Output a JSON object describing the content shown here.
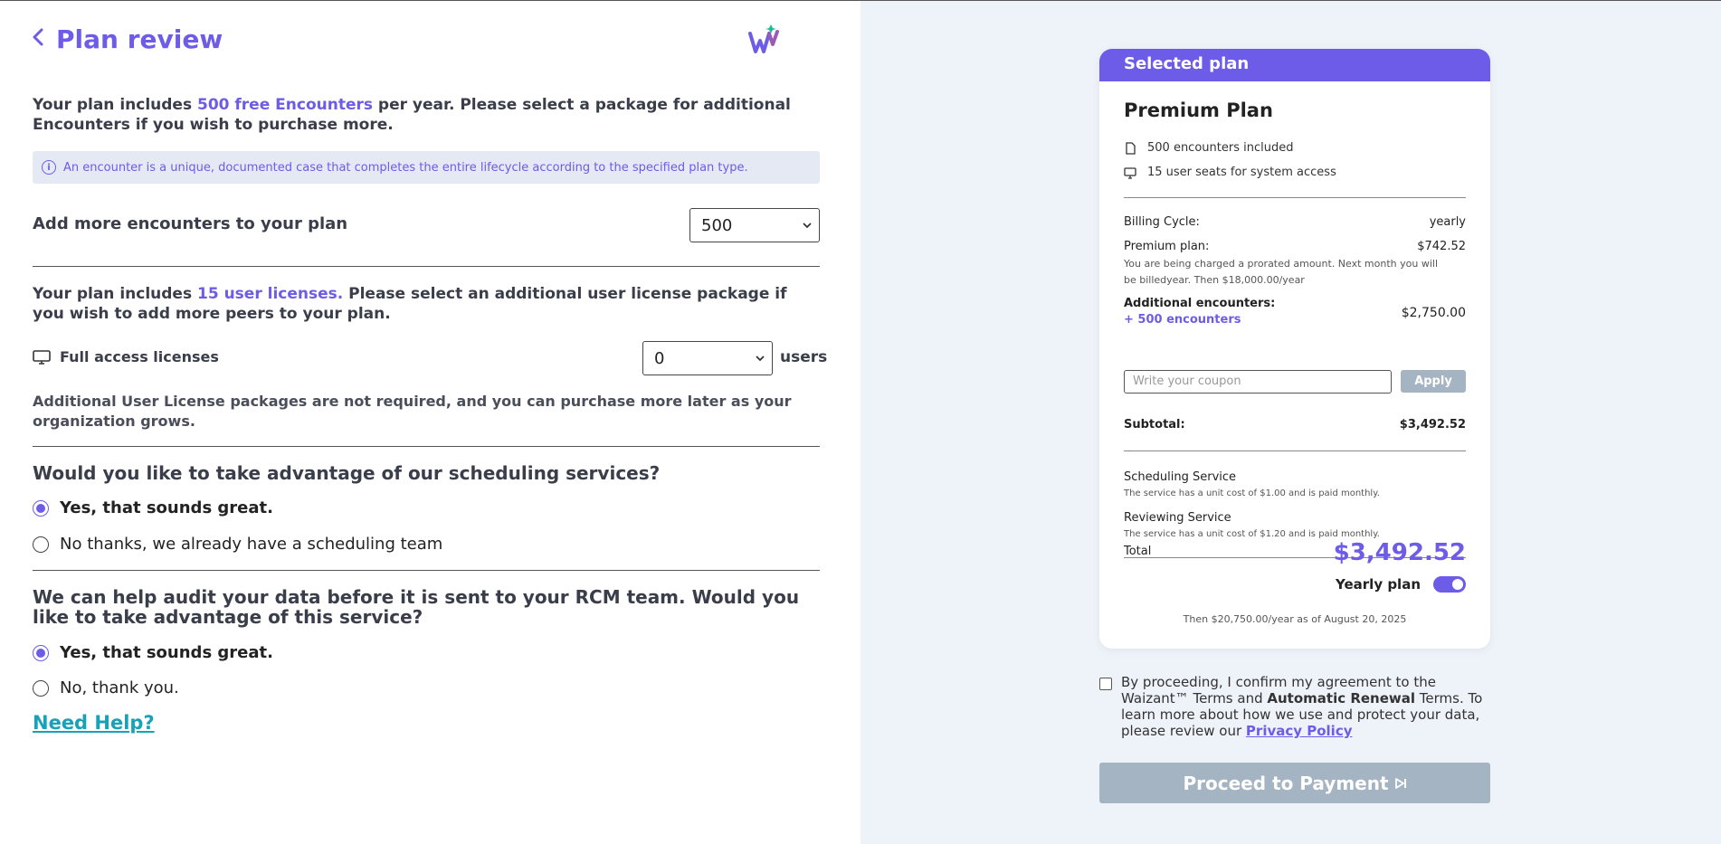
{
  "header": {
    "back_icon": "chevron-left-icon",
    "title": "Plan review",
    "logo": "waizant-logo"
  },
  "encounters": {
    "intro_pre": "Your plan includes ",
    "intro_accent": "500 free Encounters",
    "intro_post": " per year. Please select a package for additional Encounters if you wish to purchase more.",
    "info_text": "An encounter is a unique, documented case that completes the entire lifecycle according to the specified plan type.",
    "add_label": "Add more encounters to your plan",
    "selected": "500"
  },
  "licenses": {
    "intro_pre": "Your plan includes ",
    "intro_accent": "15 user licenses.",
    "intro_post": " Please select an additional user license package if you wish to add more peers to your plan.",
    "row_label": "Full access licenses",
    "selected": "0",
    "unit": "users",
    "note": "Additional User License packages are not required, and you can purchase more later as your organization grows."
  },
  "scheduling": {
    "question": "Would you like to take advantage of our scheduling services?",
    "options": [
      "Yes, that sounds great.",
      "No thanks, we already have a scheduling team"
    ],
    "selected_index": 0
  },
  "audit": {
    "question": "We can help audit your data before it is sent to your RCM team. Would you like to take advantage of this service?",
    "options": [
      "Yes, that sounds great.",
      "No, thank you."
    ],
    "selected_index": 0
  },
  "help_link": "Need Help?",
  "summary": {
    "header": "Selected plan",
    "plan_name": "Premium Plan",
    "features": [
      "500 encounters included",
      "15 user seats for system access"
    ],
    "billing_cycle_label": "Billing Cycle:",
    "billing_cycle_value": "yearly",
    "premium_label": "Premium plan:",
    "premium_value": "$742.52",
    "prorated_note": "You are being charged a prorated amount. Next month you will be billedyear. Then $18,000.00/year",
    "additional_label": "Additional encounters:",
    "additional_detail": "+ 500 encounters",
    "additional_value": "$2,750.00",
    "coupon_placeholder": "Write your coupon",
    "apply_label": "Apply",
    "subtotal_label": "Subtotal:",
    "subtotal_value": "$3,492.52",
    "services": [
      {
        "title": "Scheduling Service",
        "desc": "The service has a unit cost of $1.00 and is paid monthly."
      },
      {
        "title": "Reviewing Service",
        "desc": "The service has a unit cost of $1.20 and is paid monthly."
      }
    ],
    "total_label": "Total",
    "total_value": "$3,492.52",
    "yearly_label": "Yearly plan",
    "yearly_on": true,
    "then_note": "Then $20,750.00/year as of August 20, 2025"
  },
  "agreement": {
    "text_1": "By proceeding, I confirm my agreement to the Waizant™ Terms and ",
    "text_bold": "Automatic Renewal",
    "text_2": " Terms. To learn more about how we use and protect your data, please review our ",
    "privacy_link": "Privacy Policy",
    "checked": false
  },
  "proceed_label": "Proceed to Payment",
  "colors": {
    "accent": "#6c5ce7",
    "help_link": "#17a2b8",
    "disabled_button": "#a4b4c2",
    "panel_bg": "#eef2f9"
  }
}
